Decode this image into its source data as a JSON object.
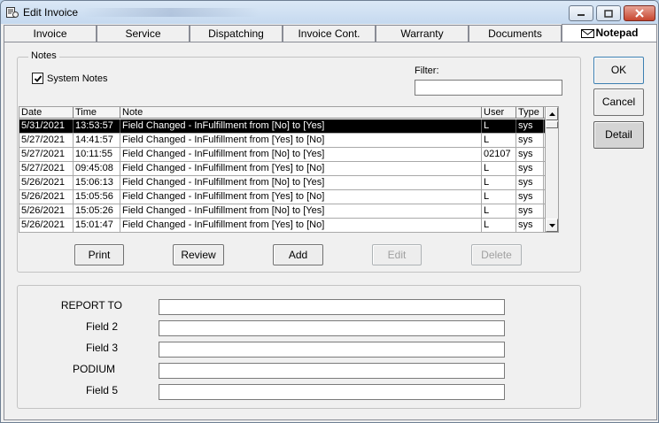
{
  "window": {
    "title": "Edit Invoice",
    "title_icon": "invoice-app-icon"
  },
  "tabs": [
    {
      "label": "Invoice",
      "active": false
    },
    {
      "label": "Service",
      "active": false
    },
    {
      "label": "Dispatching",
      "active": false
    },
    {
      "label": "Invoice Cont.",
      "active": false
    },
    {
      "label": "Warranty",
      "active": false
    },
    {
      "label": "Documents",
      "active": false
    },
    {
      "label": "Notepad",
      "active": true,
      "icon": "envelope-icon"
    }
  ],
  "notes": {
    "group_label": "Notes",
    "system_notes_label": "System Notes",
    "system_notes_checked": true,
    "filter_label": "Filter:",
    "filter_value": "",
    "columns": {
      "date": "Date",
      "time": "Time",
      "note": "Note",
      "user": "User",
      "type": "Type"
    },
    "rows": [
      {
        "date": "5/31/2021",
        "time": "13:53:57",
        "note": "Field Changed - InFulfillment from [No] to [Yes]",
        "user": "L",
        "type": "sys",
        "selected": true
      },
      {
        "date": "5/27/2021",
        "time": "14:41:57",
        "note": "Field Changed - InFulfillment from [Yes] to [No]",
        "user": "L",
        "type": "sys"
      },
      {
        "date": "5/27/2021",
        "time": "10:11:55",
        "note": "Field Changed - InFulfillment from [No] to [Yes]",
        "user": "02107",
        "type": "sys"
      },
      {
        "date": "5/27/2021",
        "time": "09:45:08",
        "note": "Field Changed - InFulfillment from [Yes] to [No]",
        "user": "L",
        "type": "sys"
      },
      {
        "date": "5/26/2021",
        "time": "15:06:13",
        "note": "Field Changed - InFulfillment from [No] to [Yes]",
        "user": "L",
        "type": "sys"
      },
      {
        "date": "5/26/2021",
        "time": "15:05:56",
        "note": "Field Changed - InFulfillment from [Yes] to [No]",
        "user": "L",
        "type": "sys"
      },
      {
        "date": "5/26/2021",
        "time": "15:05:26",
        "note": "Field Changed - InFulfillment from [No] to [Yes]",
        "user": "L",
        "type": "sys"
      },
      {
        "date": "5/26/2021",
        "time": "15:01:47",
        "note": "Field Changed - InFulfillment from [Yes] to [No]",
        "user": "L",
        "type": "sys"
      }
    ],
    "buttons": {
      "print": {
        "label": "Print",
        "enabled": true
      },
      "review": {
        "label": "Review",
        "enabled": true
      },
      "add": {
        "label": "Add",
        "enabled": true
      },
      "edit": {
        "label": "Edit",
        "enabled": false
      },
      "delete": {
        "label": "Delete",
        "enabled": false
      }
    }
  },
  "fields": [
    {
      "label": "REPORT TO",
      "value": ""
    },
    {
      "label": "Field 2",
      "value": ""
    },
    {
      "label": "Field 3",
      "value": ""
    },
    {
      "label": "PODIUM",
      "value": ""
    },
    {
      "label": "Field 5",
      "value": ""
    }
  ],
  "side_buttons": {
    "ok": "OK",
    "cancel": "Cancel",
    "detail": "Detail"
  }
}
